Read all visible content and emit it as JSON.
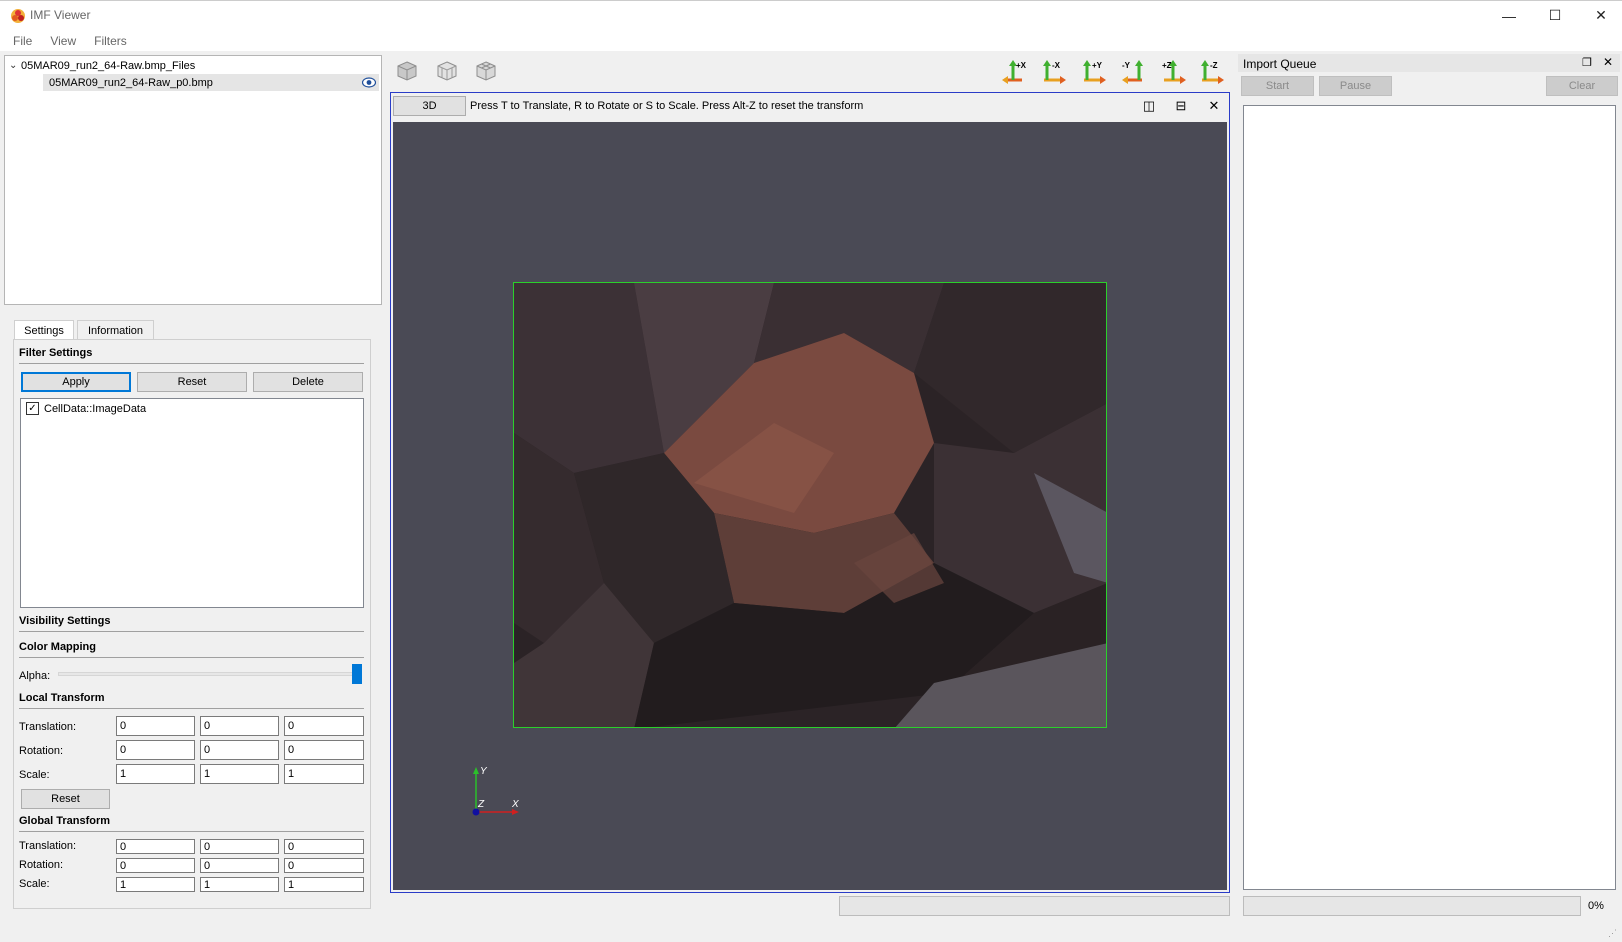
{
  "window": {
    "title": "IMF Viewer",
    "minimize_glyph": "—",
    "maximize_glyph": "☐",
    "close_glyph": "✕"
  },
  "menu": [
    "File",
    "View",
    "Filters"
  ],
  "tree": {
    "root": "05MAR09_run2_64-Raw.bmp_Files",
    "child": "05MAR09_run2_64-Raw_p0.bmp"
  },
  "tabs": {
    "settings": "Settings",
    "information": "Information"
  },
  "filter_settings": {
    "title": "Filter Settings",
    "apply": "Apply",
    "reset": "Reset",
    "delete": "Delete",
    "arrays": [
      {
        "label": "CellData::ImageData",
        "checked": true
      }
    ]
  },
  "visibility_settings": {
    "title": "Visibility Settings"
  },
  "color_mapping": {
    "title": "Color Mapping",
    "alpha_label": "Alpha:",
    "alpha_value": 1.0
  },
  "local_transform": {
    "title": "Local Transform",
    "translation_label": "Translation:",
    "rotation_label": "Rotation:",
    "scale_label": "Scale:",
    "translation": [
      "0",
      "0",
      "0"
    ],
    "rotation": [
      "0",
      "0",
      "0"
    ],
    "scale": [
      "1",
      "1",
      "1"
    ],
    "reset": "Reset"
  },
  "global_transform": {
    "title": "Global Transform",
    "translation_label": "Translation:",
    "rotation_label": "Rotation:",
    "scale_label": "Scale:",
    "translation": [
      "0",
      "0",
      "0"
    ],
    "rotation": [
      "0",
      "0",
      "0"
    ],
    "scale": [
      "1",
      "1",
      "1"
    ]
  },
  "toolbar": {
    "view_icons": [
      "cube-front-view-icon",
      "cube-wireframe-icon",
      "cube-axes-icon"
    ],
    "axis_buttons": [
      "+X",
      "-X",
      "+Y",
      "-Y",
      "+Z",
      "-Z"
    ]
  },
  "viewport": {
    "mode_button": "3D",
    "hint": "Press T to Translate, R to Rotate or S to Scale. Press Alt-Z to reset the transform",
    "split_h_glyph": "◫",
    "split_v_glyph": "⊟",
    "close_glyph": "✕",
    "background": "#4a4a55",
    "outline_color": "#2bd02b",
    "axes": {
      "y": "Y",
      "z": "Z",
      "x": "X"
    }
  },
  "import_queue": {
    "title": "Import Queue",
    "float_glyph": "❐",
    "close_glyph": "✕",
    "start": "Start",
    "pause": "Pause",
    "clear": "Clear",
    "progress_text": "0%",
    "progress": 0
  },
  "status": {
    "grip_glyph": "⋰"
  }
}
